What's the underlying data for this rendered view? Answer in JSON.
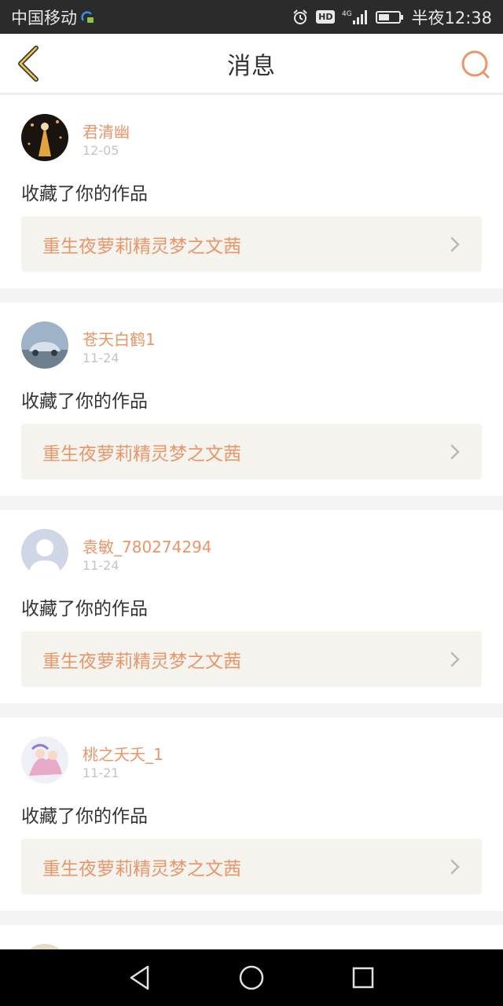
{
  "status_bar": {
    "carrier": "中国移动",
    "time": "半夜12:38",
    "network": "4G",
    "hd": "HD",
    "icons": [
      "sim-icon",
      "alarm-icon",
      "hd-icon",
      "signal-icon",
      "battery-icon"
    ]
  },
  "header": {
    "title": "消息",
    "back_icon": "back-icon",
    "search_icon": "search-icon"
  },
  "messages": [
    {
      "user": "君清幽",
      "date": "12-05",
      "action": "收藏了你的作品",
      "work": "重生夜萝莉精灵梦之文茜"
    },
    {
      "user": "苍天白鹤1",
      "date": "11-24",
      "action": "收藏了你的作品",
      "work": "重生夜萝莉精灵梦之文茜"
    },
    {
      "user": "袁敏_780274294",
      "date": "11-24",
      "action": "收藏了你的作品",
      "work": "重生夜萝莉精灵梦之文茜"
    },
    {
      "user": "桃之夭夭_1",
      "date": "11-21",
      "action": "收藏了你的作品",
      "work": "重生夜萝莉精灵梦之文茜"
    }
  ],
  "colors": {
    "accent": "#e8966a",
    "status_bar": "#2b2b2b",
    "card_link_bg": "#f4f3ee"
  },
  "system_nav": [
    "back-nav-icon",
    "home-nav-icon",
    "recents-nav-icon"
  ]
}
